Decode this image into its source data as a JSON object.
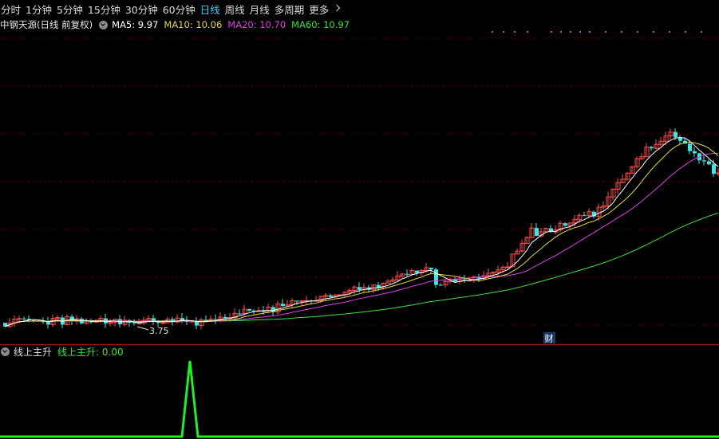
{
  "toolbar": {
    "tabs": [
      {
        "label": "分时",
        "active": false
      },
      {
        "label": "1分钟",
        "active": false
      },
      {
        "label": "5分钟",
        "active": false
      },
      {
        "label": "15分钟",
        "active": false
      },
      {
        "label": "30分钟",
        "active": false
      },
      {
        "label": "60分钟",
        "active": false
      },
      {
        "label": "日线",
        "active": true
      },
      {
        "label": "周线",
        "active": false
      },
      {
        "label": "月线",
        "active": false
      },
      {
        "label": "多周期",
        "active": false
      },
      {
        "label": "更多",
        "active": false
      }
    ]
  },
  "chart_legend": {
    "title": "中钢天源(日线 前复权)",
    "ma5": "MA5: 9.97",
    "ma10": "MA10: 10.06",
    "ma20": "MA20: 10.70",
    "ma60": "MA60: 10.97"
  },
  "annotations": {
    "low_price_label": "3.75",
    "event_badge": "财"
  },
  "indicator": {
    "name": "线上主升",
    "value_text": "线上主升: 0.00"
  },
  "colors": {
    "background": "#000000",
    "up": "#ff4d4d",
    "down": "#3de6e6",
    "ma5": "#ffffff",
    "ma10": "#e6d84a",
    "ma20": "#e040e0",
    "ma60": "#3ee03e",
    "grid": "#5a0000",
    "separator": "#a01010",
    "active_tab": "#3dd1ff",
    "indicator_line": "#22ee22"
  },
  "icons": {
    "more_chevron": "chevron-right-icon",
    "legend_toggle": "chevron-down-circle-icon"
  }
}
